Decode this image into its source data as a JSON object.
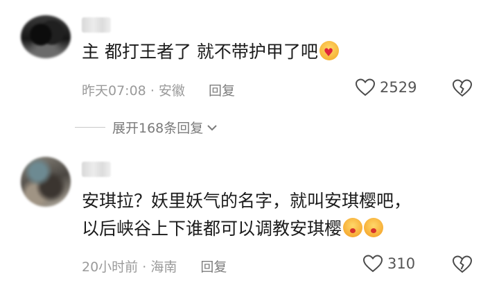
{
  "comments": [
    {
      "text": "主 都打王者了 就不带护甲了吧",
      "emoji": "smiling-face-with-hearts",
      "time": "昨天07:08",
      "location": "安徽",
      "reply_label": "回复",
      "likes": "2529"
    },
    {
      "text_line1": "安琪拉？妖里妖气的名字，就叫安琪樱吧，",
      "text_line2": "以后峡谷上下谁都可以调教安琪樱",
      "emoji": "kissing-face",
      "time": "20小时前",
      "location": "海南",
      "reply_label": "回复",
      "likes": "310"
    }
  ],
  "expand_replies": "展开168条回复",
  "separator": "·"
}
